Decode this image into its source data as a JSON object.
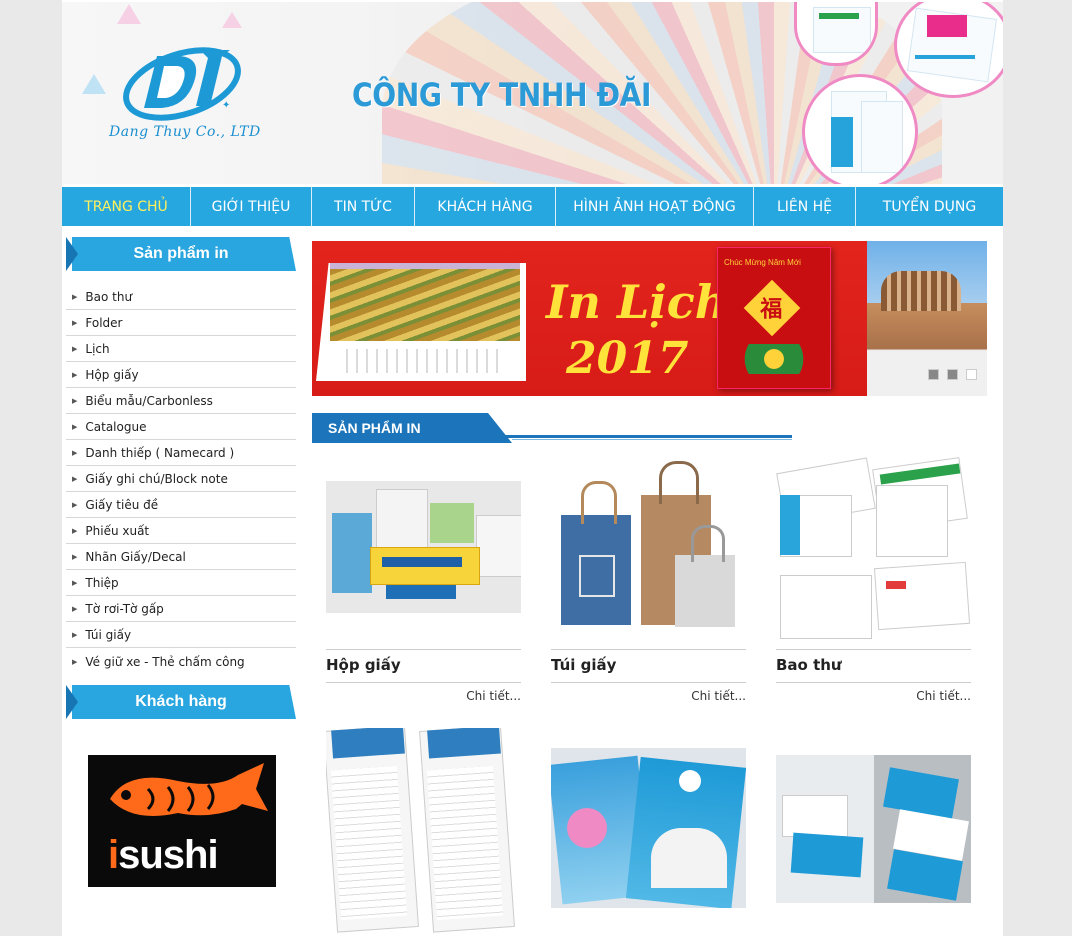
{
  "header": {
    "logo_text": "Dang Thuy Co., LTD",
    "company_name": "CÔNG TY TNHH ĐĂI"
  },
  "nav": {
    "items": [
      {
        "label": "TRANG CHỦ",
        "active": true
      },
      {
        "label": "GIỚI THIỆU",
        "active": false
      },
      {
        "label": "TIN TỨC",
        "active": false
      },
      {
        "label": "KHÁCH HÀNG",
        "active": false
      },
      {
        "label": "HÌNH ẢNH HOẠT ĐỘNG",
        "active": false
      },
      {
        "label": "LIÊN HỆ",
        "active": false
      },
      {
        "label": "TUYỂN DỤNG",
        "active": false
      }
    ]
  },
  "sidebar": {
    "products_title": "Sản phẩm in",
    "categories": [
      "Bao thư",
      "Folder",
      "Lịch",
      "Hộp giấy",
      "Biểu mẫu/Carbonless",
      "Catalogue",
      "Danh thiếp ( Namecard )",
      "Giấy ghi chú/Block note",
      "Giấy tiêu đề",
      "Phiếu xuất",
      "Nhãn Giấy/Decal",
      "Thiệp",
      "Tờ rơi-Tờ gấp",
      "Túi giấy",
      "Vé giữ xe - Thẻ chấm công"
    ],
    "customers_title": "Khách hàng",
    "customer_logo_text": "isushi"
  },
  "banner": {
    "line1": "In Lịch",
    "line2": "2017",
    "card_text": "Chúc Mừng Năm Mới",
    "card_char": "福"
  },
  "section": {
    "title": "SẢN PHẨM IN"
  },
  "products": [
    {
      "name": "Hộp giấy",
      "more": "Chi tiết..."
    },
    {
      "name": "Túi giấy",
      "more": "Chi tiết..."
    },
    {
      "name": "Bao thư",
      "more": "Chi tiết..."
    }
  ],
  "colors": {
    "nav_bg": "#27a7df",
    "active_nav": "#fff05c",
    "section_blue": "#1c75ba",
    "banner_red": "#e2241d"
  }
}
